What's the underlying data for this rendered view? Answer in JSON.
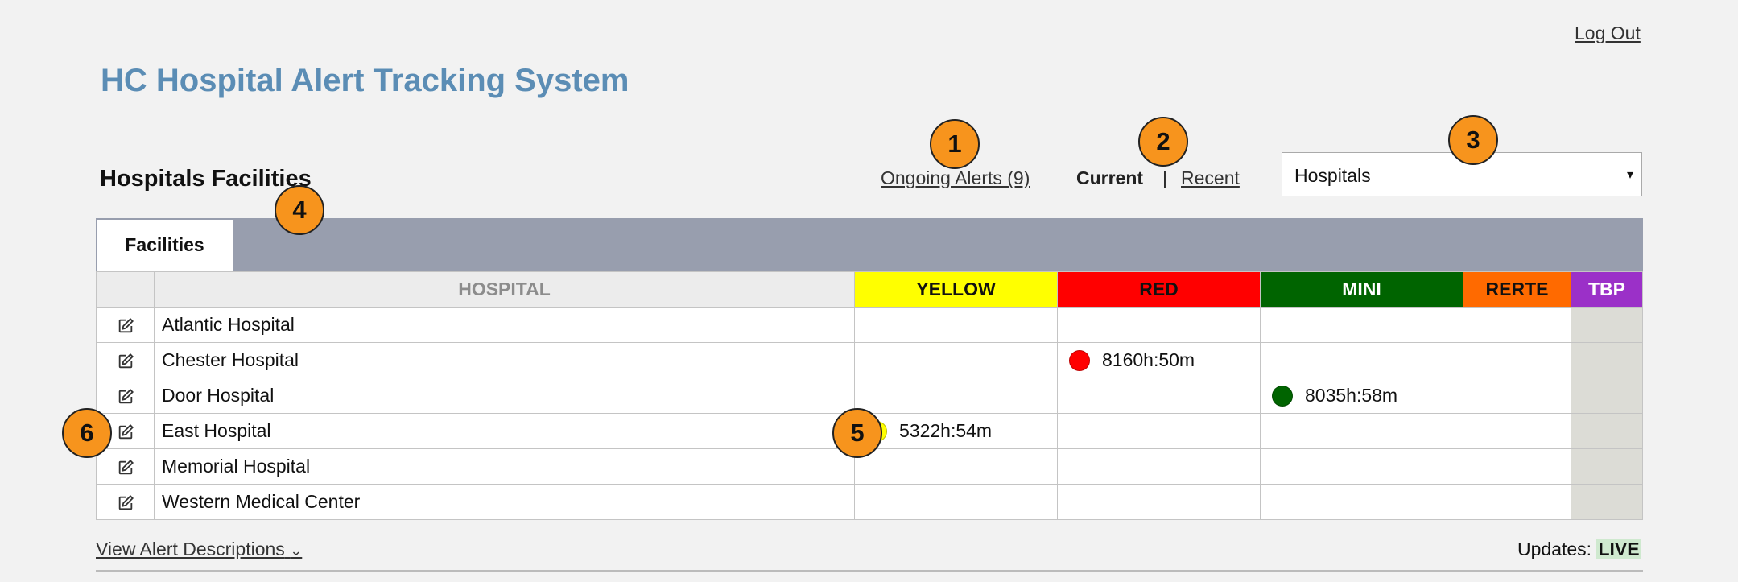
{
  "header": {
    "logout_label": "Log Out",
    "app_title": "HC Hospital Alert Tracking System",
    "section_title": "Hospitals Facilities"
  },
  "nav": {
    "ongoing_alerts": "Ongoing Alerts (9)",
    "current": "Current",
    "separator": "|",
    "recent": "Recent"
  },
  "facility_select": {
    "selected": "Hospitals",
    "caret": "▾"
  },
  "tabs": [
    {
      "label": "Facilities",
      "active": true
    }
  ],
  "table": {
    "columns": {
      "hospital": "HOSPITAL",
      "yellow": "YELLOW",
      "red": "RED",
      "mini": "MINI",
      "rerte": "RERTE",
      "tbp": "TBP"
    },
    "column_colors": {
      "yellow": "#ffff00",
      "red": "#ff0000",
      "mini": "#006400",
      "rerte": "#ff6a00",
      "tbp": "#9b30c8"
    },
    "rows": [
      {
        "name": "Atlantic Hospital",
        "yellow": "",
        "red": "",
        "mini": "",
        "rerte": "",
        "tbp": ""
      },
      {
        "name": "Chester Hospital",
        "yellow": "",
        "red": "8160h:50m",
        "mini": "",
        "rerte": "",
        "tbp": ""
      },
      {
        "name": "Door Hospital",
        "yellow": "",
        "red": "",
        "mini": "8035h:58m",
        "rerte": "",
        "tbp": ""
      },
      {
        "name": "East Hospital",
        "yellow": "5322h:54m",
        "red": "",
        "mini": "",
        "rerte": "",
        "tbp": ""
      },
      {
        "name": "Memorial Hospital",
        "yellow": "",
        "red": "",
        "mini": "",
        "rerte": "",
        "tbp": ""
      },
      {
        "name": "Western Medical Center",
        "yellow": "",
        "red": "",
        "mini": "",
        "rerte": "",
        "tbp": ""
      }
    ],
    "edit_icon": "edit-icon"
  },
  "footer": {
    "view_descriptions": "View Alert Descriptions",
    "chevron": "⌄",
    "updates_label": "Updates:",
    "updates_status": "LIVE"
  },
  "markers": [
    "1",
    "2",
    "3",
    "4",
    "5",
    "6"
  ]
}
